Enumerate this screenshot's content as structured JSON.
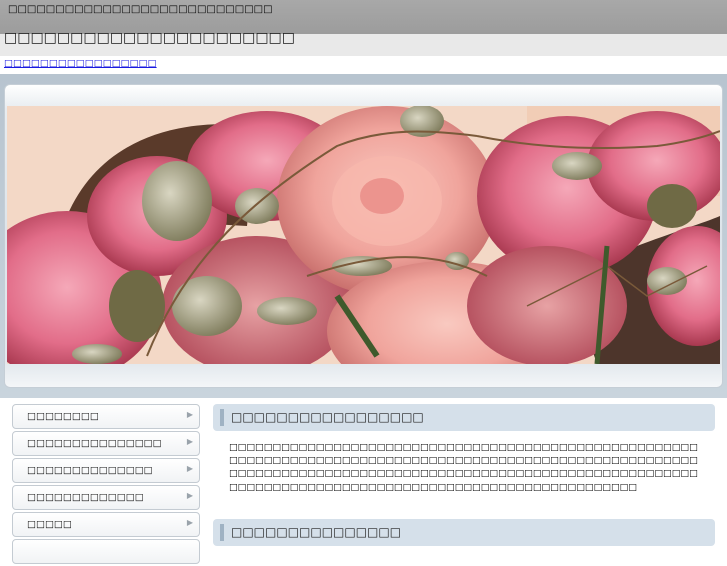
{
  "header": {
    "tagline": "□□□□□□□□□□□□□□□□□□□□□□□□□□□□",
    "site_title": "□□□□□□□□□□□□□□□□□□□□□□",
    "top_link": "□□□□□□□□□□□□□□□□□"
  },
  "hero": {
    "image_alt": "roses-photo"
  },
  "sidebar": {
    "items": [
      {
        "label": "□□□□□□□□"
      },
      {
        "label": "□□□□□□□□□□□□□□□"
      },
      {
        "label": "□□□□□□□□□□□□□□"
      },
      {
        "label": "□□□□□□□□□□□□□"
      },
      {
        "label": "□□□□□"
      }
    ]
  },
  "main": {
    "section1_title": "□□□□□□□□□□□□□□□□□",
    "section1_text": "□□□□□□□□□□□□□□□□□□□□□□□□□□□□□□□□□□□□□□□□□□□□□□□□□□□□□□□□□□□□□□□□□□□□□□□□□□□□□□□□□□□□□□□□□□□□□□□□□□□□□□□□□□□□□□□□□□□□□□□□□□□□□□□□□□□□□□□□□□□□□□□□□□□□□□□□□□□□□□□□□□□□□□□□□□□□□□□□□□□□□□□□□□□□□□□□□□□□□□□□□□□□□□□□□",
    "section2_title": "□□□□□□□□□□□□□□□"
  },
  "colors": {
    "topbar": "#a3a3a3",
    "titlebar": "#e9e9e9",
    "link": "#1a1ae0",
    "heading_bg": "#d5e0ea"
  }
}
